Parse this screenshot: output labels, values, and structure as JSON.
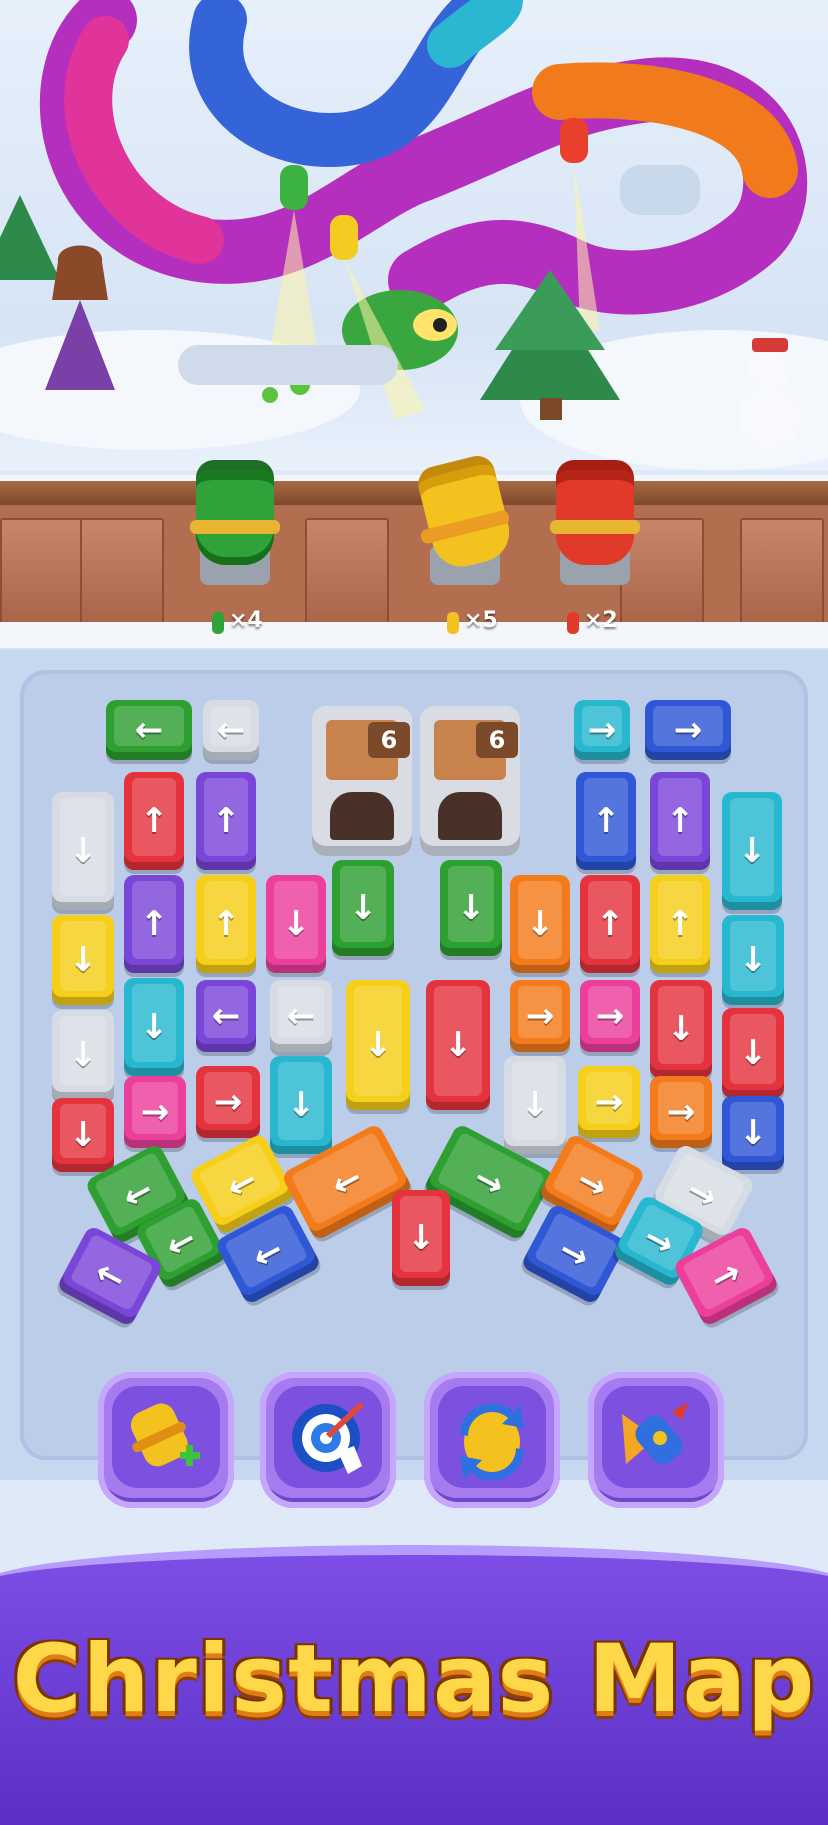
{
  "title": "Christmas Map",
  "cannons": [
    {
      "color": "#2fa23a",
      "count": "×4"
    },
    {
      "color": "#f3c21e",
      "count": "×5"
    },
    {
      "color": "#e23a2a",
      "count": "×2"
    }
  ],
  "crates": [
    {
      "value": "6"
    },
    {
      "value": "6"
    }
  ],
  "tools": [
    {
      "name": "add-cannon-icon"
    },
    {
      "name": "target-icon"
    },
    {
      "name": "shuffle-icon"
    },
    {
      "name": "rocket-icon"
    }
  ],
  "palette": {
    "green": "#2e9f31",
    "red": "#e5333e",
    "yellow": "#f5cf19",
    "blue": "#2f57d6",
    "purple": "#7a46d8",
    "pink": "#ec3f9b",
    "cyan": "#27b7cf",
    "orange": "#f47b1c",
    "white": "#d7dce4"
  }
}
